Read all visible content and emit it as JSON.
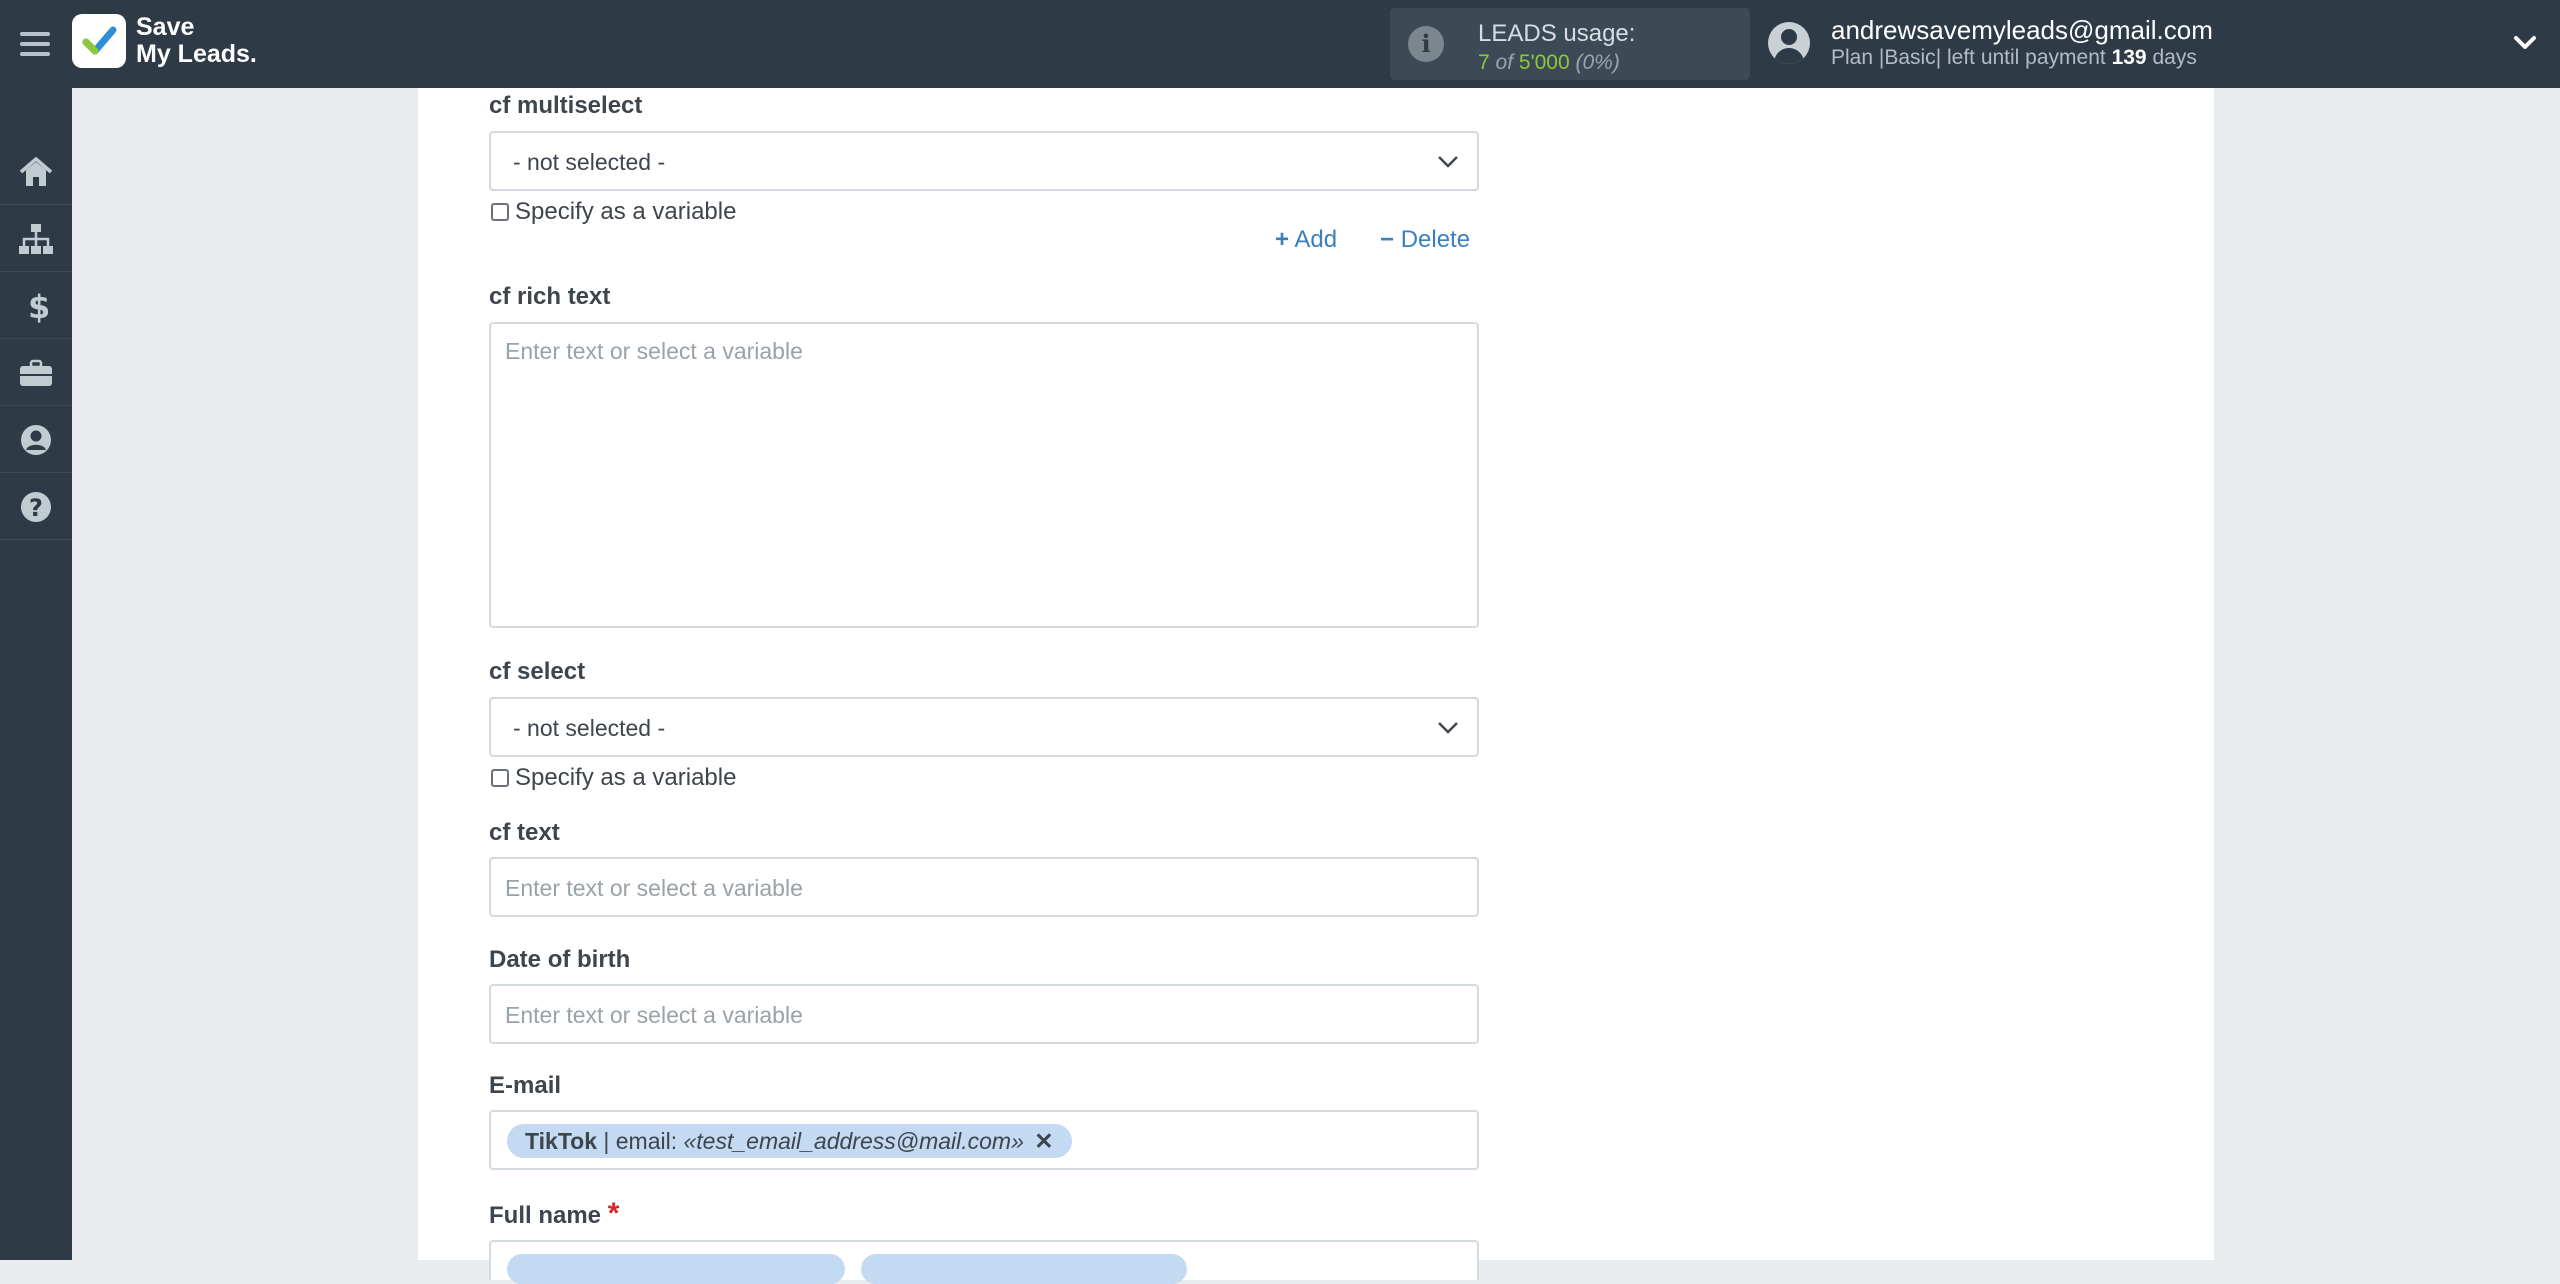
{
  "header": {
    "brand_line1": "Save",
    "brand_line2": "My Leads.",
    "usage_label": "LEADS usage:",
    "usage_used": "7",
    "usage_of": "of",
    "usage_total": "5'000",
    "usage_pct": "(0%)",
    "user_email": "andrewsavemyleads@gmail.com",
    "plan_prefix": "Plan |",
    "plan_name": "Basic",
    "plan_mid": "| left until payment",
    "plan_days": "139",
    "plan_suffix": "days"
  },
  "sidebar": {
    "icons": [
      "home-icon",
      "sitemap-icon",
      "dollar-icon",
      "briefcase-icon",
      "user-circle-icon",
      "help-icon"
    ]
  },
  "form": {
    "cf_multiselect": {
      "label": "cf multiselect",
      "value": "- not selected -",
      "variable_label": "Specify as a variable",
      "add": "Add",
      "delete": "Delete"
    },
    "cf_rich_text": {
      "label": "cf rich text",
      "placeholder": "Enter text or select a variable"
    },
    "cf_select": {
      "label": "cf select",
      "value": "- not selected -",
      "variable_label": "Specify as a variable"
    },
    "cf_text": {
      "label": "cf text",
      "placeholder": "Enter text or select a variable"
    },
    "date_of_birth": {
      "label": "Date of birth",
      "placeholder": "Enter text or select a variable"
    },
    "email": {
      "label": "E-mail",
      "tag_source": "TikTok",
      "tag_field": "| email:",
      "tag_value": "«test_email_address@mail.com»"
    },
    "full_name": {
      "label": "Full name",
      "required_mark": "*"
    }
  },
  "colors": {
    "topbar": "#2e3a45",
    "accent_link": "#3b7fbf",
    "usage_green": "#8ec73e",
    "tag_bg": "#c3daf2",
    "required": "#d9262b"
  }
}
